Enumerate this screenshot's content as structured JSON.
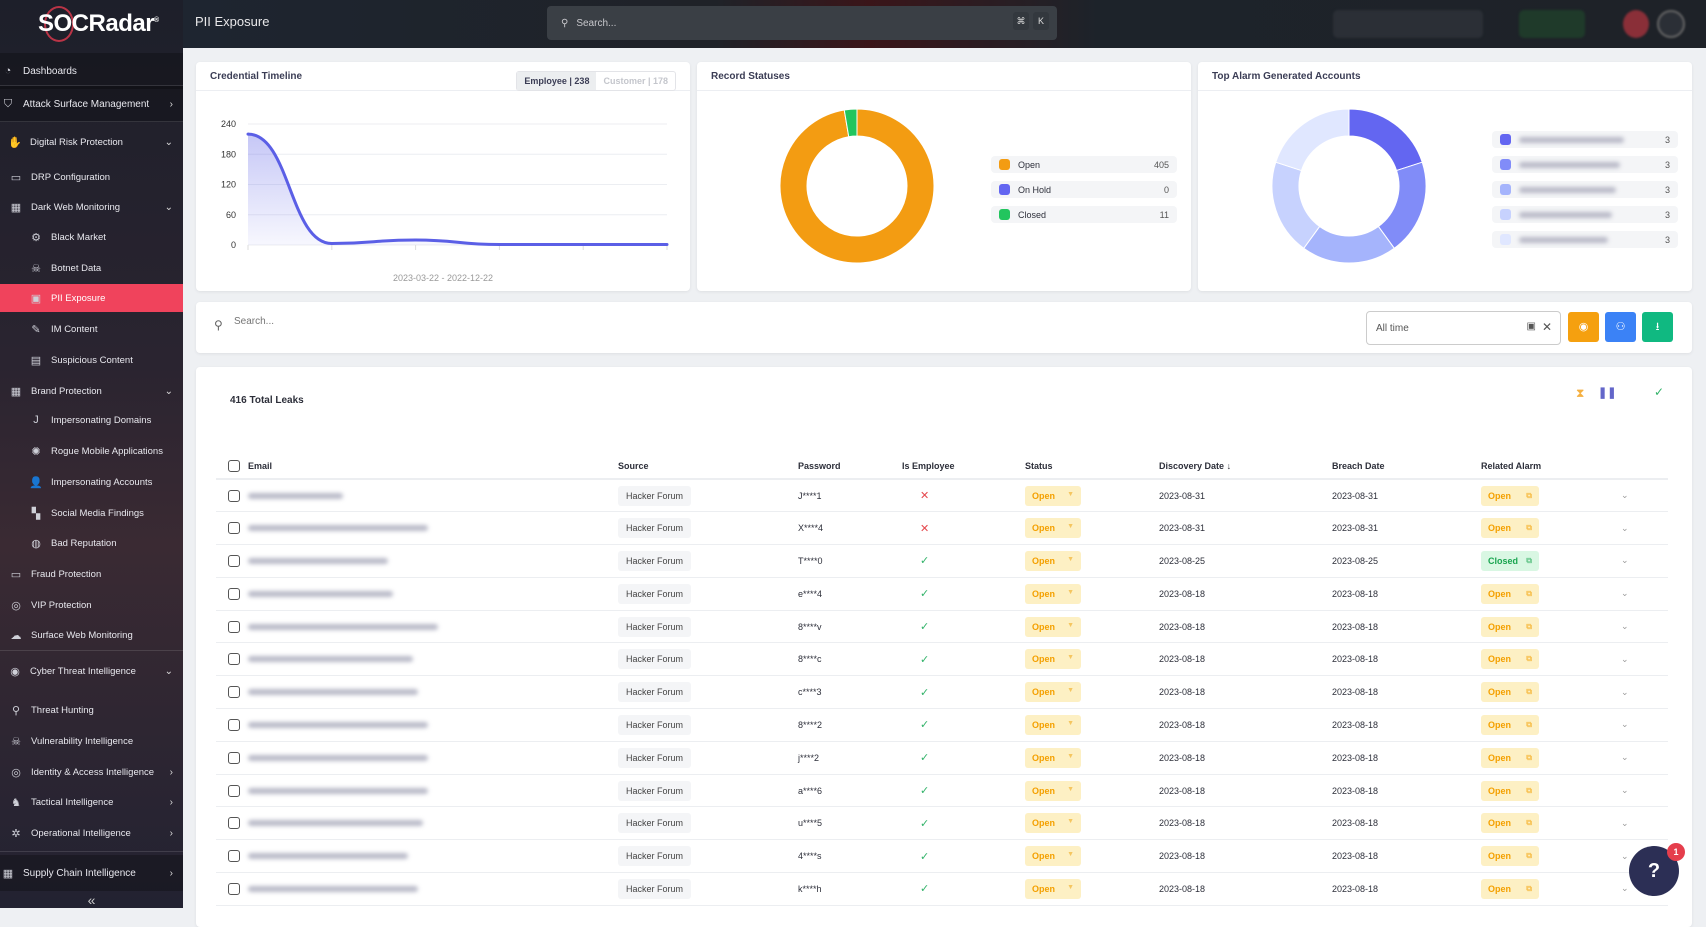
{
  "brand": {
    "name": "SOCRadar"
  },
  "header": {
    "title": "PII Exposure",
    "search_placeholder": "Search...",
    "shortcut_cmd": "⌘",
    "shortcut_key": "K"
  },
  "sidebar": {
    "items": [
      {
        "label": "Dashboards",
        "icon": "dashboard-icon"
      },
      {
        "label": "Attack Surface Management",
        "icon": "shield-scan-icon"
      },
      {
        "label": "Digital Risk Protection",
        "icon": "hand-icon"
      },
      {
        "label": "DRP Configuration",
        "icon": "monitor-icon"
      },
      {
        "label": "Dark Web Monitoring",
        "icon": "building-icon"
      },
      {
        "label": "Black Market",
        "icon": "gear-icon"
      },
      {
        "label": "Botnet Data",
        "icon": "bug-icon"
      },
      {
        "label": "PII Exposure",
        "icon": "id-card-icon"
      },
      {
        "label": "IM Content",
        "icon": "chat-icon"
      },
      {
        "label": "Suspicious Content",
        "icon": "document-icon"
      },
      {
        "label": "Brand Protection",
        "icon": "brand-icon"
      },
      {
        "label": "Impersonating Domains",
        "icon": "hook-icon"
      },
      {
        "label": "Rogue Mobile Applications",
        "icon": "virus-icon"
      },
      {
        "label": "Impersonating Accounts",
        "icon": "user-icon"
      },
      {
        "label": "Social Media Findings",
        "icon": "grid-icon"
      },
      {
        "label": "Bad Reputation",
        "icon": "globe-icon"
      },
      {
        "label": "Fraud Protection",
        "icon": "card-icon"
      },
      {
        "label": "VIP Protection",
        "icon": "fingerprint-icon"
      },
      {
        "label": "Surface Web Monitoring",
        "icon": "cloud-icon"
      },
      {
        "label": "Cyber Threat Intelligence",
        "icon": "eye-shield-icon"
      },
      {
        "label": "Threat Hunting",
        "icon": "search-icon"
      },
      {
        "label": "Vulnerability Intelligence",
        "icon": "bug-icon"
      },
      {
        "label": "Identity & Access Intelligence",
        "icon": "fingerprint-icon"
      },
      {
        "label": "Tactical Intelligence",
        "icon": "chess-icon"
      },
      {
        "label": "Operational Intelligence",
        "icon": "network-icon"
      },
      {
        "label": "Supply Chain Intelligence",
        "icon": "factory-icon"
      }
    ],
    "collapse": "«"
  },
  "timeline": {
    "title": "Credential Timeline",
    "tabs": [
      {
        "label": "Employee | 238",
        "active": true
      },
      {
        "label": "Customer | 178",
        "active": false
      }
    ],
    "date_range": "2023-03-22 - 2022-12-22"
  },
  "record_statuses": {
    "title": "Record Statuses"
  },
  "top_alarm": {
    "title": "Top Alarm Generated Accounts"
  },
  "chart_data": [
    {
      "type": "area",
      "title": "Credential Timeline",
      "y_ticks": [
        "240",
        "180",
        "120",
        "60",
        "0"
      ],
      "ylim": [
        0,
        240
      ],
      "grid": true,
      "x_label": "2023-03-22 - 2022-12-22",
      "values": [
        220,
        3,
        10,
        1,
        1,
        1
      ],
      "color": "#5b5fe6"
    },
    {
      "type": "pie",
      "title": "Record Statuses",
      "donut": true,
      "legend": "right",
      "series": [
        {
          "name": "Open",
          "value": 405,
          "color": "#f39c12"
        },
        {
          "name": "On Hold",
          "value": 0,
          "color": "#6366f1"
        },
        {
          "name": "Closed",
          "value": 11,
          "color": "#22c55e"
        }
      ]
    },
    {
      "type": "pie",
      "title": "Top Alarm Generated Accounts",
      "donut": true,
      "legend": "right",
      "series": [
        {
          "value": 3,
          "color": "#6366f1"
        },
        {
          "value": 3,
          "color": "#818cf8"
        },
        {
          "value": 3,
          "color": "#a5b4fc"
        },
        {
          "value": 3,
          "color": "#c7d2fe"
        },
        {
          "value": 3,
          "color": "#e0e7ff"
        }
      ]
    }
  ],
  "filter": {
    "search_placeholder": "Search...",
    "date_value": "All time",
    "buttons": [
      {
        "icon": "eye-off-icon",
        "color": "#f5a00f"
      },
      {
        "icon": "user-settings-icon",
        "color": "#3b82f6"
      },
      {
        "icon": "download-icon",
        "color": "#10b981"
      }
    ]
  },
  "leaks": {
    "total": "416 Total Leaks",
    "columns": [
      "Email",
      "Source",
      "Password",
      "Is Employee",
      "Status",
      "Discovery Date",
      "Breach Date",
      "Related Alarm"
    ],
    "sort_indicator": "↓",
    "rows": [
      {
        "source": "Hacker Forum",
        "password": "J****1",
        "employee": false,
        "status": "Open",
        "discovery": "2023-08-31",
        "breach": "2023-08-31",
        "alarm": "Open"
      },
      {
        "source": "Hacker Forum",
        "password": "X****4",
        "employee": false,
        "status": "Open",
        "discovery": "2023-08-31",
        "breach": "2023-08-31",
        "alarm": "Open"
      },
      {
        "source": "Hacker Forum",
        "password": "T****0",
        "employee": true,
        "status": "Open",
        "discovery": "2023-08-25",
        "breach": "2023-08-25",
        "alarm": "Closed"
      },
      {
        "source": "Hacker Forum",
        "password": "e****4",
        "employee": true,
        "status": "Open",
        "discovery": "2023-08-18",
        "breach": "2023-08-18",
        "alarm": "Open"
      },
      {
        "source": "Hacker Forum",
        "password": "8****v",
        "employee": true,
        "status": "Open",
        "discovery": "2023-08-18",
        "breach": "2023-08-18",
        "alarm": "Open"
      },
      {
        "source": "Hacker Forum",
        "password": "8****c",
        "employee": true,
        "status": "Open",
        "discovery": "2023-08-18",
        "breach": "2023-08-18",
        "alarm": "Open"
      },
      {
        "source": "Hacker Forum",
        "password": "c****3",
        "employee": true,
        "status": "Open",
        "discovery": "2023-08-18",
        "breach": "2023-08-18",
        "alarm": "Open"
      },
      {
        "source": "Hacker Forum",
        "password": "8****2",
        "employee": true,
        "status": "Open",
        "discovery": "2023-08-18",
        "breach": "2023-08-18",
        "alarm": "Open"
      },
      {
        "source": "Hacker Forum",
        "password": "j****2",
        "employee": true,
        "status": "Open",
        "discovery": "2023-08-18",
        "breach": "2023-08-18",
        "alarm": "Open"
      },
      {
        "source": "Hacker Forum",
        "password": "a****6",
        "employee": true,
        "status": "Open",
        "discovery": "2023-08-18",
        "breach": "2023-08-18",
        "alarm": "Open"
      },
      {
        "source": "Hacker Forum",
        "password": "u****5",
        "employee": true,
        "status": "Open",
        "discovery": "2023-08-18",
        "breach": "2023-08-18",
        "alarm": "Open"
      },
      {
        "source": "Hacker Forum",
        "password": "4****s",
        "employee": true,
        "status": "Open",
        "discovery": "2023-08-18",
        "breach": "2023-08-18",
        "alarm": "Open"
      },
      {
        "source": "Hacker Forum",
        "password": "k****h",
        "employee": true,
        "status": "Open",
        "discovery": "2023-08-18",
        "breach": "2023-08-18",
        "alarm": "Open"
      }
    ]
  },
  "help": {
    "badge": "1"
  }
}
